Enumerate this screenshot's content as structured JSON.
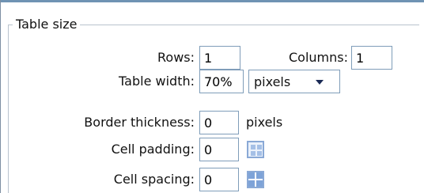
{
  "fieldset": {
    "legend": "Table size"
  },
  "fields": {
    "rows": {
      "label": "Rows:",
      "value": "1"
    },
    "columns": {
      "label": "Columns:",
      "value": "1"
    },
    "table_width": {
      "label": "Table width:",
      "value": "70%",
      "unit_selected": "pixels"
    },
    "border_thickness": {
      "label": "Border thickness:",
      "value": "0",
      "unit": "pixels"
    },
    "cell_padding": {
      "label": "Cell padding:",
      "value": "0",
      "icon": "cell-padding-icon"
    },
    "cell_spacing": {
      "label": "Cell spacing:",
      "value": "0",
      "icon": "cell-spacing-icon"
    }
  },
  "colors": {
    "input_border": "#7f9db9",
    "accent_line": "#6f93b3",
    "icon_blue": "#8aa9d6"
  }
}
